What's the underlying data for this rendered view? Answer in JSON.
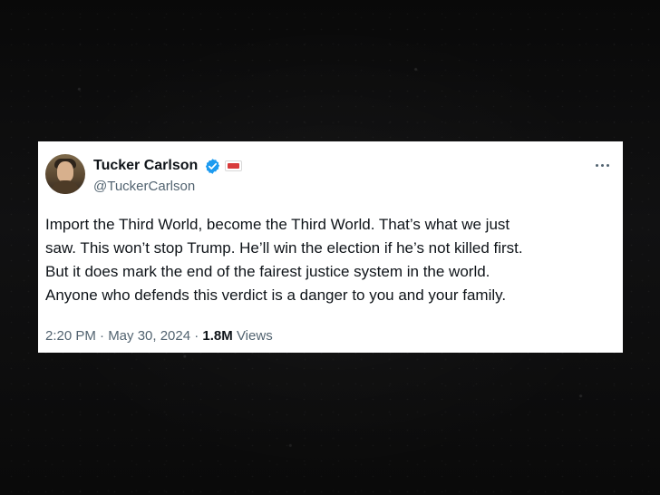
{
  "tweet": {
    "display_name": "Tucker Carlson",
    "username": "@TuckerCarlson",
    "lines": [
      "Import the Third World, become the Third World. That’s what we just",
      "saw. This won’t stop Trump. He’ll win the election if he’s not killed first.",
      "But it does mark the end of the fairest justice system in the world.",
      "Anyone who defends this verdict is a danger to you and your family."
    ],
    "timestamp": "2:20 PM · May 30, 2024 ·",
    "views_count": "1.8M",
    "views_label": "Views"
  },
  "icons": {
    "verified": "verified-badge-icon",
    "affiliate": "affiliate-badge-icon",
    "more": "more-icon"
  },
  "colors": {
    "background": "#0b0b0c",
    "card": "#ffffff",
    "text_primary": "#0f1419",
    "text_secondary": "#536471",
    "verified_blue": "#1d9bf0",
    "affiliate_red": "#d83b3b"
  }
}
